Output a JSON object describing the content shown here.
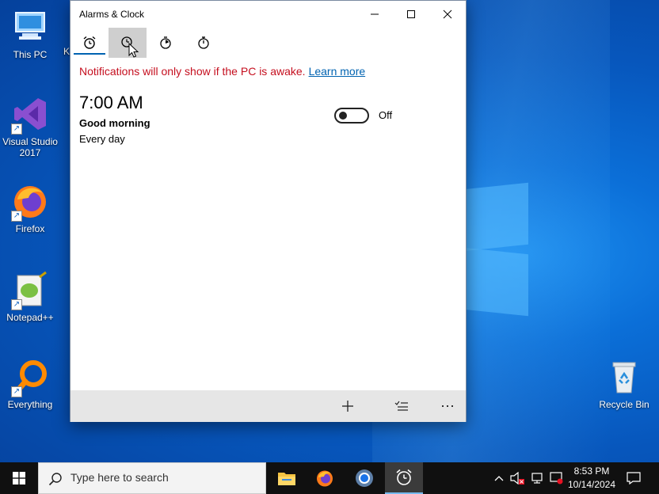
{
  "desktop": {
    "icons": [
      {
        "label": "This PC",
        "icon": "computer-icon"
      },
      {
        "label": "Visual Studio 2017",
        "icon": "visual-studio-icon"
      },
      {
        "label": "Firefox",
        "icon": "firefox-icon"
      },
      {
        "label": "Notepad++",
        "icon": "notepadpp-icon"
      },
      {
        "label": "Everything",
        "icon": "everything-search-icon"
      },
      {
        "label": "Recycle Bin",
        "icon": "recycle-bin-icon"
      }
    ],
    "partial_label": "K"
  },
  "window": {
    "title": "Alarms & Clock",
    "tabs": [
      {
        "icon": "alarm-icon",
        "selected": true
      },
      {
        "icon": "world-clock-icon",
        "hovered": true
      },
      {
        "icon": "timer-icon"
      },
      {
        "icon": "stopwatch-icon"
      }
    ],
    "notice": {
      "text": "Notifications will only show if the PC is awake.",
      "link": "Learn more"
    },
    "alarm": {
      "time": "7:00 AM",
      "name": "Good morning",
      "repeat": "Every day",
      "toggle_label": "Off",
      "enabled": false
    },
    "commands": {
      "add": "+",
      "more": "⋯"
    }
  },
  "taskbar": {
    "search_placeholder": "Type here to search",
    "time": "8:53 PM",
    "date": "10/14/2024"
  },
  "colors": {
    "accent": "#0063b1",
    "notice": "#c50f1f",
    "taskbar": "#101010"
  }
}
